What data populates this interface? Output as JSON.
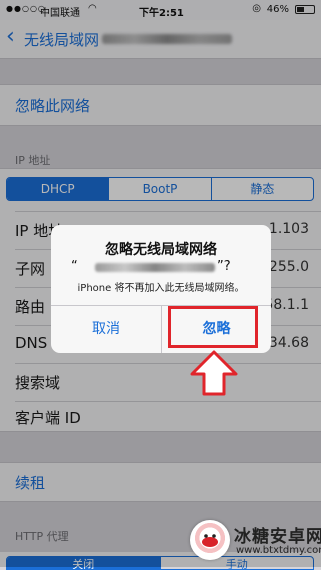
{
  "status_bar": {
    "signal": "●●○○○",
    "carrier": "中国联通",
    "time": "下午2:51",
    "battery": "46%",
    "battery_fraction": 0.46
  },
  "nav": {
    "back_label": "无线局域网"
  },
  "forget_label": "忽略此网络",
  "ip_section": {
    "header": "IP 地址",
    "segments": [
      "DHCP",
      "BootP",
      "静态"
    ],
    "selected_segment": "DHCP"
  },
  "rows": [
    {
      "label": "IP 地址",
      "value": "1.103"
    },
    {
      "label": "子网",
      "value": "255.0"
    },
    {
      "label": "路由",
      "value": "58.1.1"
    },
    {
      "label": "DNS",
      "value": "34.68"
    },
    {
      "label": "搜索域",
      "value": ""
    },
    {
      "label": "客户端 ID",
      "value": ""
    }
  ],
  "renew_label": "续租",
  "http_proxy": {
    "header": "HTTP 代理",
    "segments": [
      "关闭",
      "手动"
    ]
  },
  "alert": {
    "title": "忽略无线局域网络",
    "ssid_open": "“",
    "ssid_close": "”?",
    "message": "iPhone 将不再加入此无线局域网络。",
    "cancel_label": "取消",
    "ignore_label": "忽略"
  },
  "watermark": {
    "brand": "冰糖安卓网",
    "url": "www.btxtdmy.com"
  },
  "colors": {
    "accent": "#1b6fd8",
    "highlight": "#e0252b",
    "background": "#d6d5da"
  }
}
